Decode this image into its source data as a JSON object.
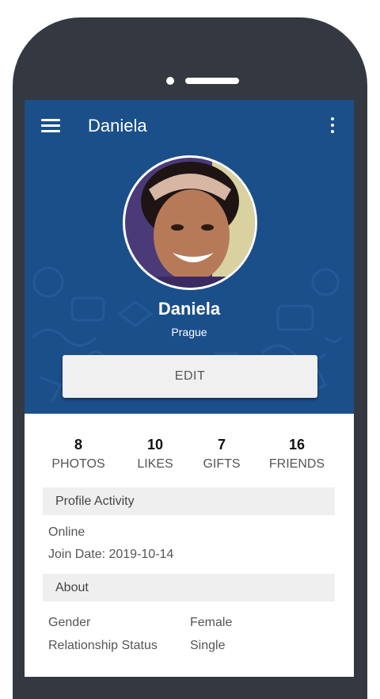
{
  "appbar": {
    "title": "Daniela"
  },
  "profile": {
    "name": "Daniela",
    "city": "Prague",
    "edit_label": "EDIT"
  },
  "stats": [
    {
      "count": "8",
      "label": "PHOTOS"
    },
    {
      "count": "10",
      "label": "LIKES"
    },
    {
      "count": "7",
      "label": "GIFTS"
    },
    {
      "count": "16",
      "label": "FRIENDS"
    }
  ],
  "activity": {
    "header": "Profile Activity",
    "status": "Online",
    "join_date": "Join Date: 2019-10-14"
  },
  "about": {
    "header": "About",
    "rows": [
      {
        "label": "Gender",
        "value": "Female"
      },
      {
        "label": "Relationship Status",
        "value": "Single"
      }
    ]
  },
  "colors": {
    "header_bg": "#1a4f8a",
    "phone_frame": "#343840",
    "section_bg": "#efefef"
  },
  "icons": {
    "menu": "hamburger-menu-icon",
    "more": "more-vertical-icon"
  }
}
